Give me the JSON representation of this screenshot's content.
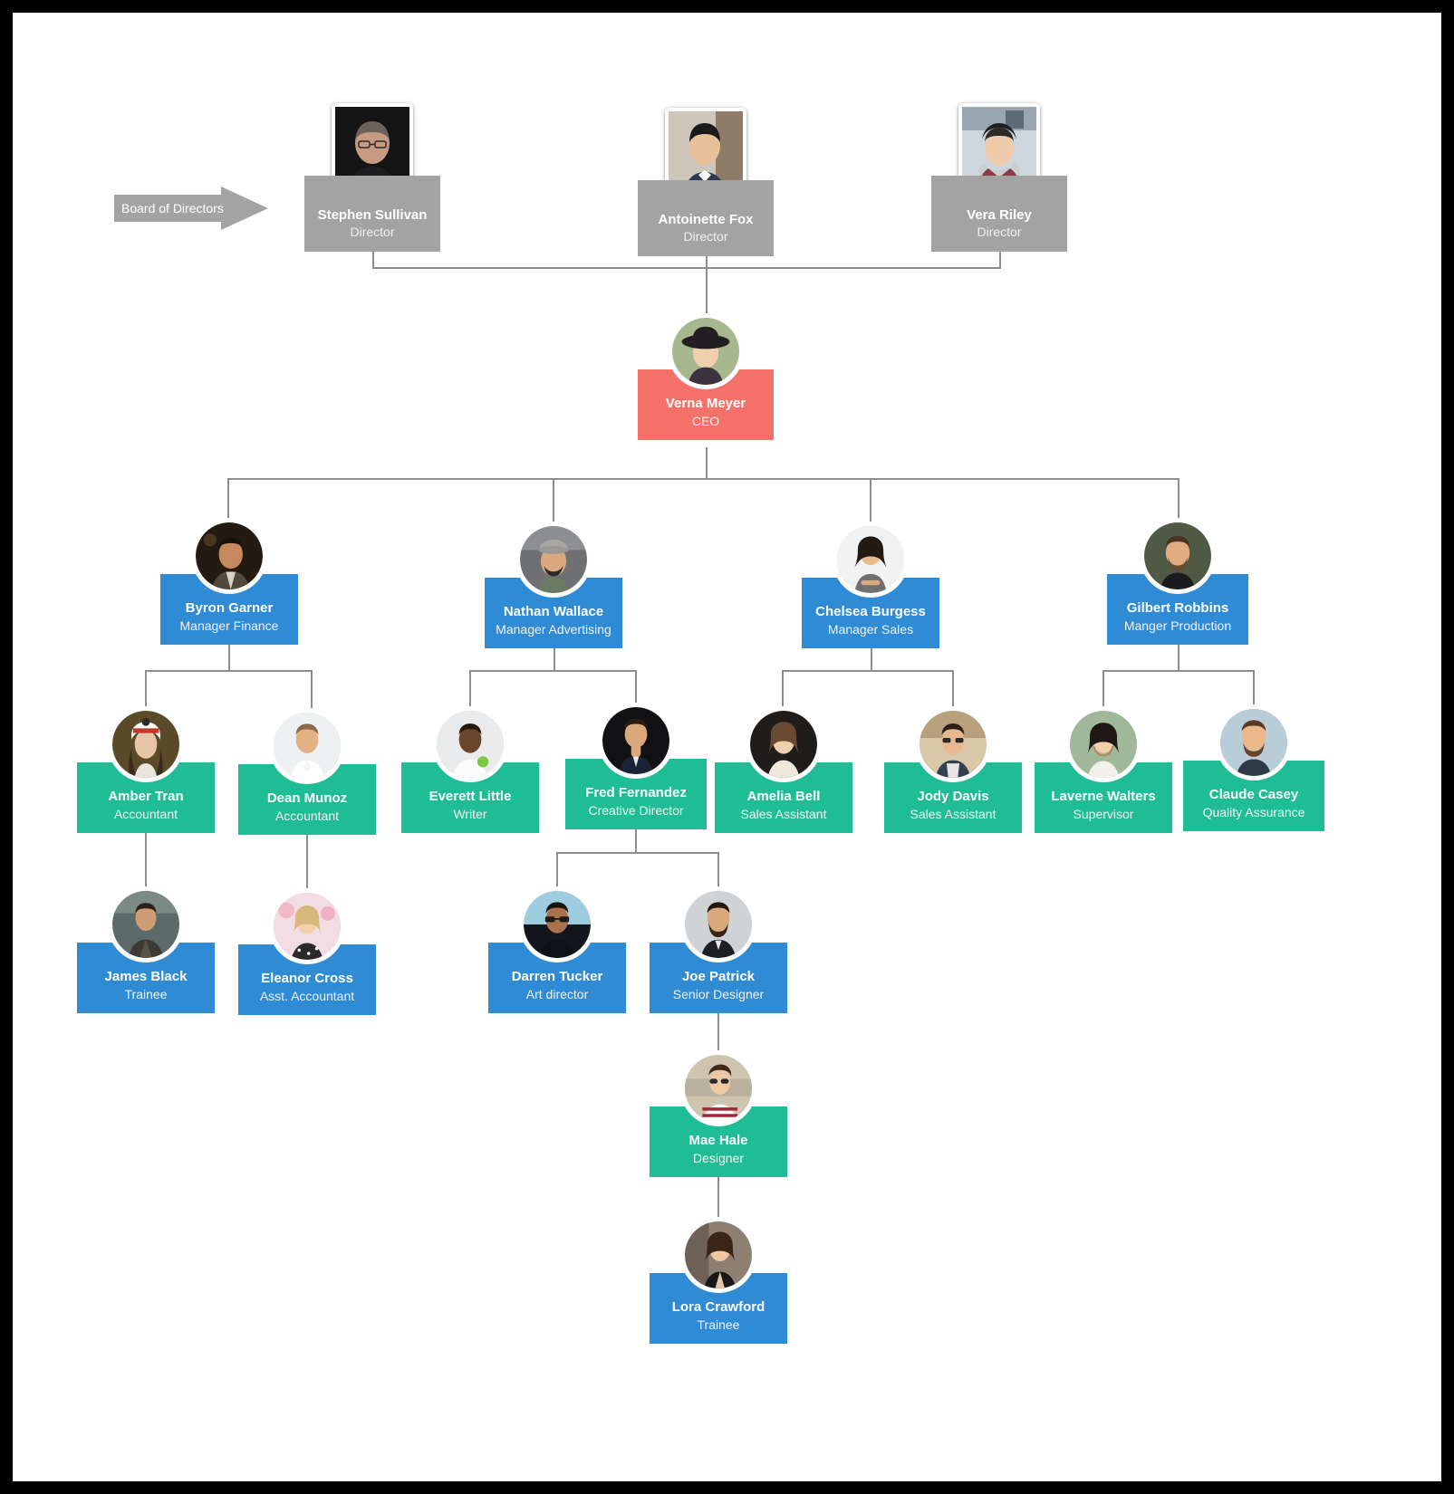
{
  "board": {
    "label": "Board of Directors"
  },
  "directors": [
    {
      "name": "Stephen Sullivan",
      "title": "Director"
    },
    {
      "name": "Antoinette Fox",
      "title": "Director"
    },
    {
      "name": "Vera Riley",
      "title": "Director"
    }
  ],
  "ceo": {
    "name": "Verna Meyer",
    "title": "CEO"
  },
  "managers": [
    {
      "name": "Byron Garner",
      "title": "Manager Finance"
    },
    {
      "name": "Nathan Wallace",
      "title": "Manager Advertising"
    },
    {
      "name": "Chelsea Burgess",
      "title": "Manager Sales"
    },
    {
      "name": "Gilbert Robbins",
      "title": "Manger Production"
    }
  ],
  "staff": [
    {
      "name": "Amber Tran",
      "title": "Accountant"
    },
    {
      "name": "Dean Munoz",
      "title": "Accountant"
    },
    {
      "name": "Everett Little",
      "title": "Writer"
    },
    {
      "name": "Fred Fernandez",
      "title": "Creative Director"
    },
    {
      "name": "Amelia Bell",
      "title": "Sales Assistant"
    },
    {
      "name": "Jody Davis",
      "title": "Sales Assistant"
    },
    {
      "name": "Laverne Walters",
      "title": "Supervisor"
    },
    {
      "name": "Claude Casey",
      "title": "Quality Assurance"
    }
  ],
  "juniors": [
    {
      "name": "James Black",
      "title": "Trainee"
    },
    {
      "name": "Eleanor Cross",
      "title": "Asst. Accountant"
    },
    {
      "name": "Darren Tucker",
      "title": "Art director"
    },
    {
      "name": "Joe Patrick",
      "title": "Senior Designer"
    }
  ],
  "designer": {
    "name": "Mae Hale",
    "title": "Designer"
  },
  "trainee": {
    "name": "Lora Crawford",
    "title": "Trainee"
  },
  "colors": {
    "director_gray": "#a3a3a3",
    "ceo_coral": "#f4716a",
    "manager_blue": "#2e8bd4",
    "staff_teal": "#1fbd96",
    "connector_gray": "#8d8d8d",
    "page_background": "#ffffff",
    "frame_black": "#000000"
  }
}
